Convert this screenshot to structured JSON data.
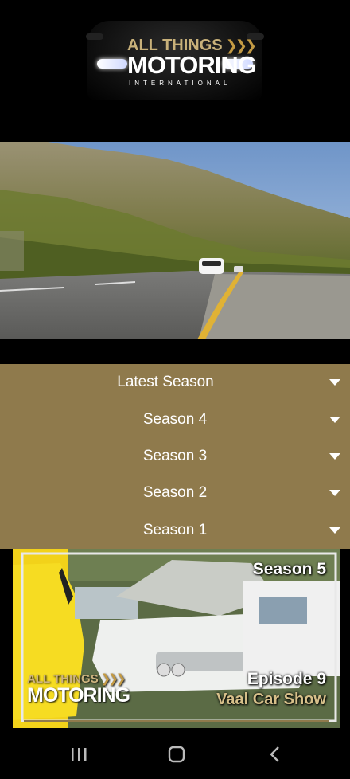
{
  "header": {
    "logo_line1": "ALL THINGS",
    "logo_line2": "MOTORING",
    "logo_line3": "INTERNATIONAL"
  },
  "menu": {
    "items": [
      {
        "label": "Latest Season"
      },
      {
        "label": "Season 4"
      },
      {
        "label": "Season 3"
      },
      {
        "label": "Season 2"
      },
      {
        "label": "Season 1"
      }
    ]
  },
  "card": {
    "season": "Season 5",
    "episode": "Episode 9",
    "title": "Vaal Car Show",
    "logo_line1": "ALL THINGS",
    "logo_line2": "MOTORING"
  },
  "nav": {
    "recent_icon": "recent-apps-icon",
    "home_icon": "home-icon",
    "back_icon": "back-icon"
  },
  "colors": {
    "menu_bg": "#8f7a4c",
    "gold_accent": "#c39a43",
    "background": "#000000"
  }
}
